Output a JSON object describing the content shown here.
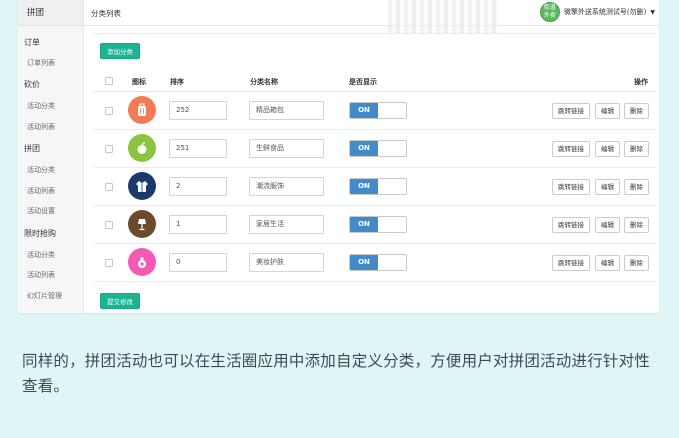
{
  "sidebar": {
    "brand": "拼团",
    "groups": [
      {
        "label": "订单",
        "items": [
          "订单列表"
        ]
      },
      {
        "label": "砍价",
        "items": [
          "活动分类",
          "活动列表"
        ]
      },
      {
        "label": "拼团",
        "items": [
          "活动分类",
          "活动列表",
          "活动设置"
        ]
      },
      {
        "label": "限时抢购",
        "items": [
          "活动分类",
          "活动列表",
          "幻灯片管理"
        ]
      }
    ]
  },
  "topbar": {
    "title": "分类列表",
    "avatar_line1": "街道",
    "avatar_line2": "外卖",
    "user_name": "微擎外送系统测试号(勿删)"
  },
  "toolbar": {
    "add_label": "添加分类",
    "submit_label": "提交修改"
  },
  "table": {
    "headers": {
      "icon": "图标",
      "sort": "排序",
      "name": "分类名称",
      "show": "是否显示",
      "actions": "操作"
    },
    "rows": [
      {
        "sort": "252",
        "name": "精品箱包",
        "toggle": "ON",
        "icon": "suitcase-icon",
        "color": "#f47a55"
      },
      {
        "sort": "251",
        "name": "生鲜食品",
        "toggle": "ON",
        "icon": "apple-icon",
        "color": "#8bc53f"
      },
      {
        "sort": "2",
        "name": "潮流服饰",
        "toggle": "ON",
        "icon": "jacket-icon",
        "color": "#1b3a6b"
      },
      {
        "sort": "1",
        "name": "家居生活",
        "toggle": "ON",
        "icon": "lamp-icon",
        "color": "#6b4a2e"
      },
      {
        "sort": "0",
        "name": "美妆护肤",
        "toggle": "ON",
        "icon": "perfume-icon",
        "color": "#f25bb3"
      }
    ],
    "action_labels": {
      "link": "跳转链接",
      "edit": "编辑",
      "delete": "删除"
    }
  },
  "caption": "同样的，拼团活动也可以在生活圈应用中添加自定义分类，方便用户对拼团活动进行针对性查看。"
}
